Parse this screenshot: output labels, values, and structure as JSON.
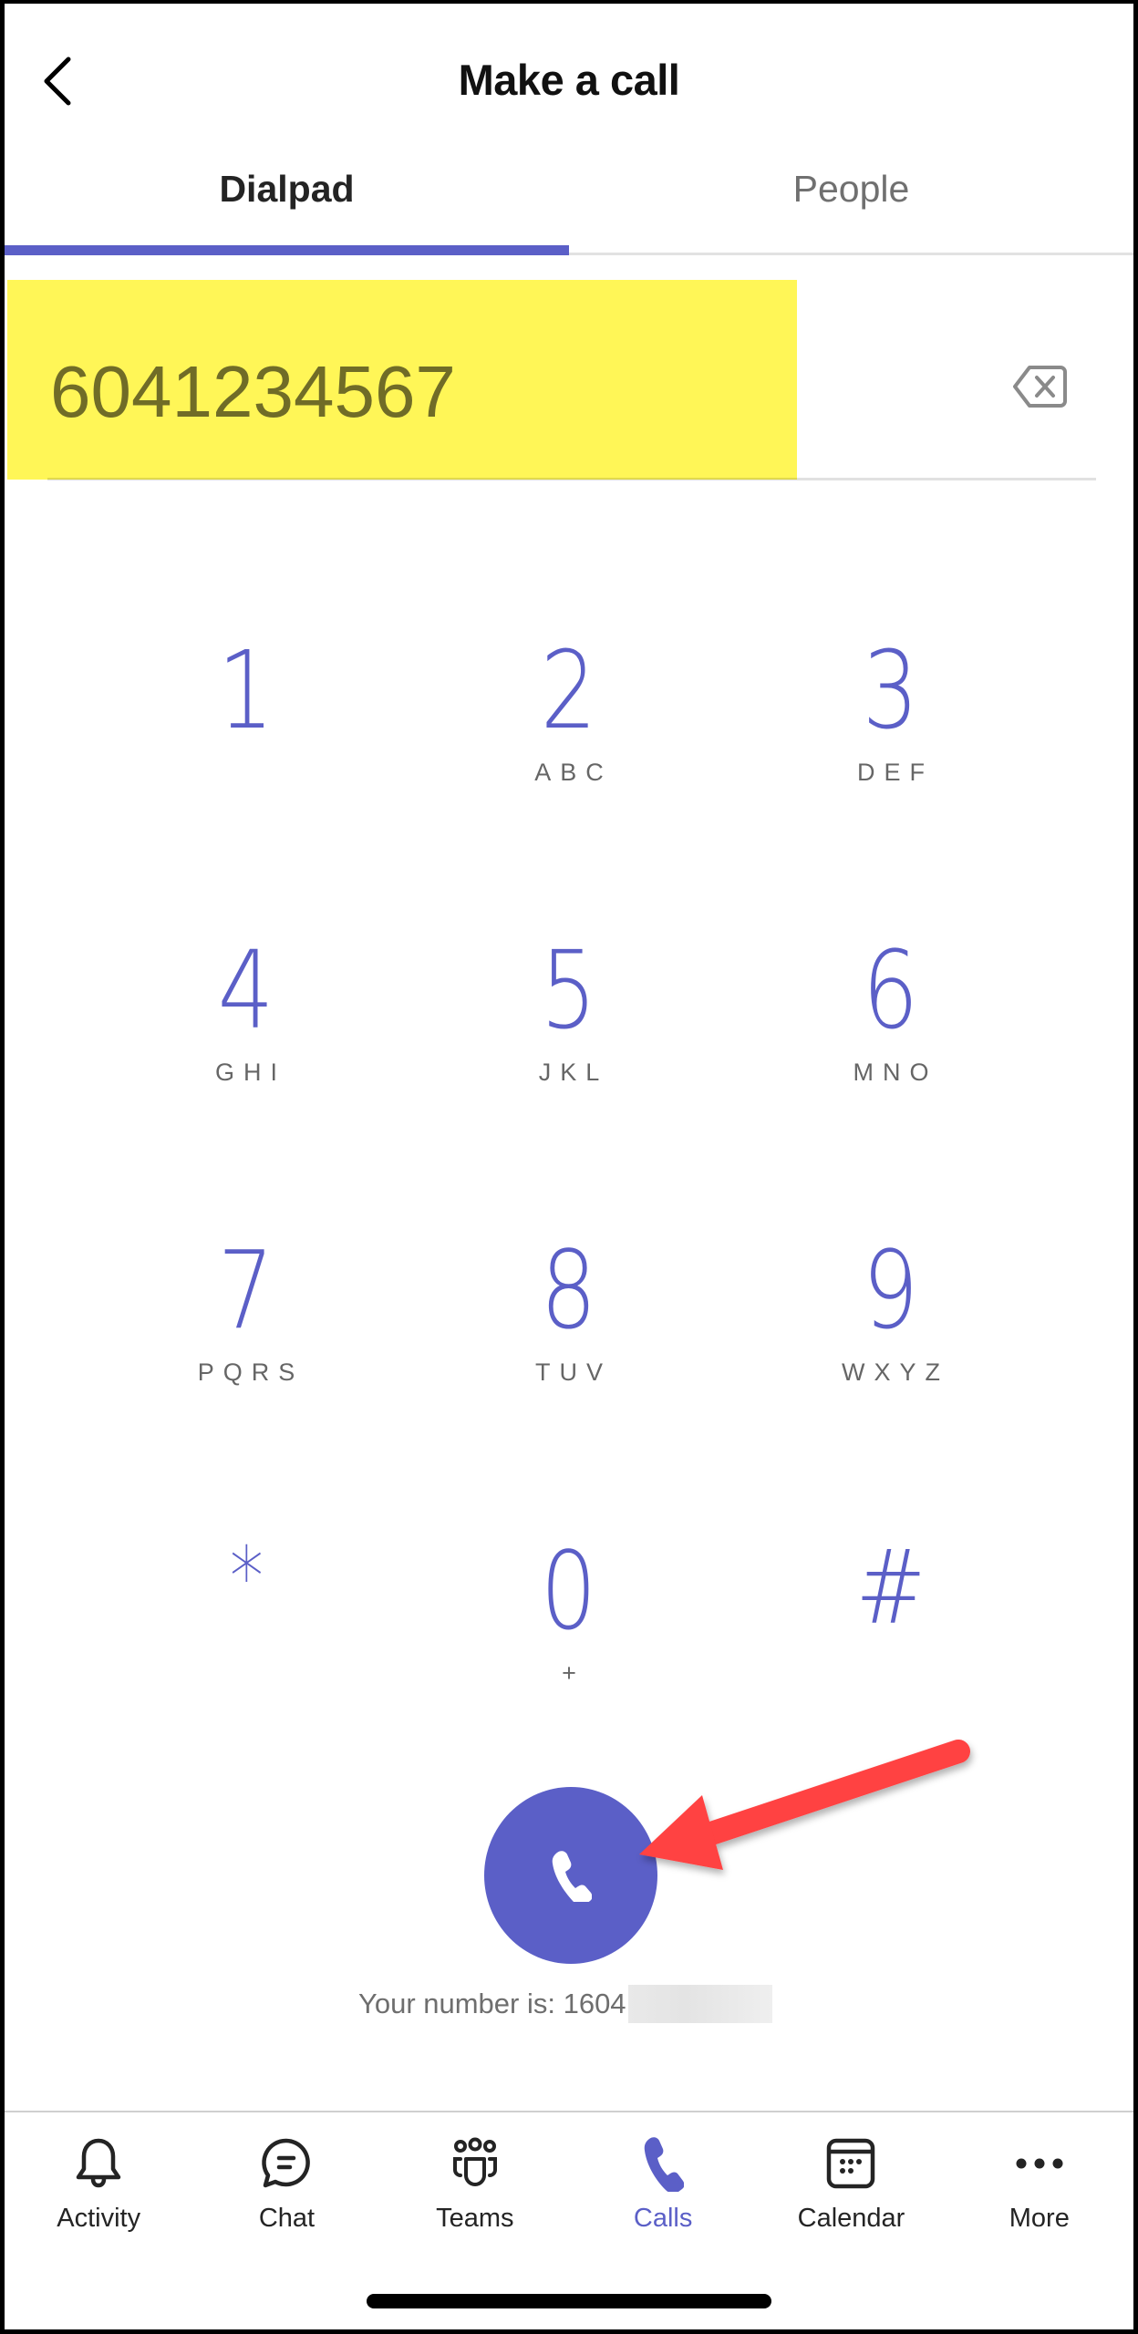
{
  "header": {
    "title": "Make a call",
    "back_icon": "chevron-left-icon"
  },
  "tabs": [
    {
      "label": "Dialpad",
      "active": true
    },
    {
      "label": "People",
      "active": false
    }
  ],
  "number_input": {
    "value": "6041234567",
    "highlighted": true,
    "highlight_color": "#FFF200",
    "backspace_icon": "backspace-icon"
  },
  "dialpad": {
    "keys": [
      {
        "digit": "1",
        "letters": ""
      },
      {
        "digit": "2",
        "letters": "ABC"
      },
      {
        "digit": "3",
        "letters": "DEF"
      },
      {
        "digit": "4",
        "letters": "GHI"
      },
      {
        "digit": "5",
        "letters": "JKL"
      },
      {
        "digit": "6",
        "letters": "MNO"
      },
      {
        "digit": "7",
        "letters": "PQRS"
      },
      {
        "digit": "8",
        "letters": "TUV"
      },
      {
        "digit": "9",
        "letters": "WXYZ"
      },
      {
        "digit": "*",
        "letters": ""
      },
      {
        "digit": "0",
        "letters": "+"
      },
      {
        "digit": "#",
        "letters": ""
      }
    ]
  },
  "call": {
    "button_icon": "phone-icon",
    "your_number_label": "Your number is: 1604",
    "your_number_redacted": true
  },
  "annotation": {
    "type": "arrow",
    "color": "#FF4040",
    "points_to": "call-button"
  },
  "bottom_nav": {
    "items": [
      {
        "label": "Activity",
        "icon": "bell-icon",
        "active": false
      },
      {
        "label": "Chat",
        "icon": "chat-icon",
        "active": false
      },
      {
        "label": "Teams",
        "icon": "teams-icon",
        "active": false
      },
      {
        "label": "Calls",
        "icon": "phone-icon",
        "active": true
      },
      {
        "label": "Calendar",
        "icon": "calendar-icon",
        "active": false
      },
      {
        "label": "More",
        "icon": "more-icon",
        "active": false
      }
    ]
  },
  "colors": {
    "accent": "#5B5FC7",
    "text_primary": "#242424",
    "text_secondary": "#707070",
    "annotation": "#FF4040"
  }
}
